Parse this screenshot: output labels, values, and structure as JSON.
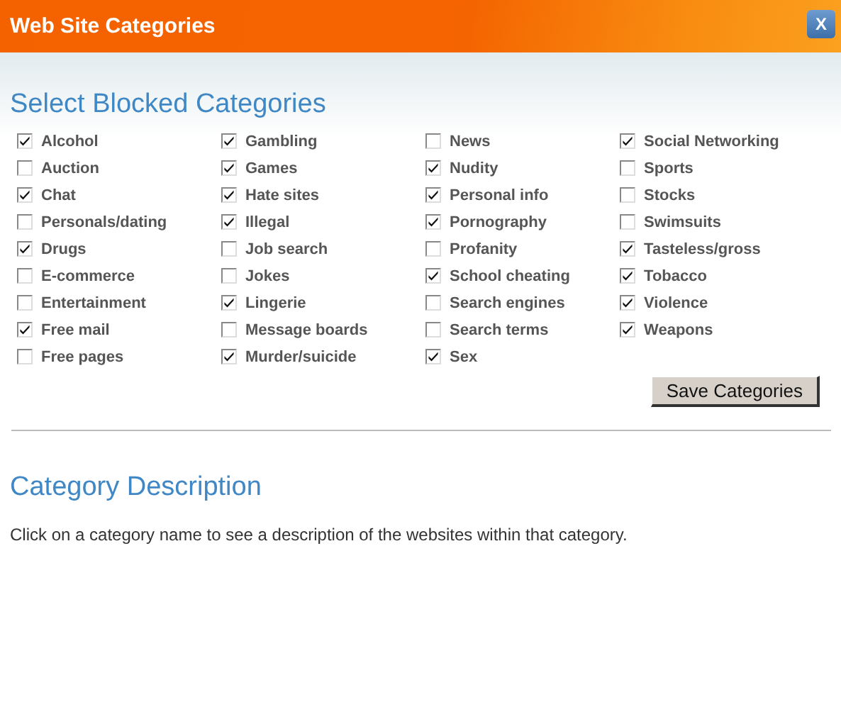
{
  "window": {
    "title": "Web Site Categories",
    "close_label": "X"
  },
  "blocked": {
    "heading": "Select Blocked Categories",
    "columns": [
      [
        {
          "label": "Alcohol",
          "checked": true
        },
        {
          "label": "Auction",
          "checked": false
        },
        {
          "label": "Chat",
          "checked": true
        },
        {
          "label": "Personals/dating",
          "checked": false
        },
        {
          "label": "Drugs",
          "checked": true
        },
        {
          "label": "E-commerce",
          "checked": false
        },
        {
          "label": "Entertainment",
          "checked": false
        },
        {
          "label": "Free mail",
          "checked": true
        },
        {
          "label": "Free pages",
          "checked": false
        }
      ],
      [
        {
          "label": "Gambling",
          "checked": true
        },
        {
          "label": "Games",
          "checked": true
        },
        {
          "label": "Hate sites",
          "checked": true
        },
        {
          "label": "Illegal",
          "checked": true
        },
        {
          "label": "Job search",
          "checked": false
        },
        {
          "label": "Jokes",
          "checked": false
        },
        {
          "label": "Lingerie",
          "checked": true
        },
        {
          "label": "Message boards",
          "checked": false
        },
        {
          "label": "Murder/suicide",
          "checked": true
        }
      ],
      [
        {
          "label": "News",
          "checked": false
        },
        {
          "label": "Nudity",
          "checked": true
        },
        {
          "label": "Personal info",
          "checked": true
        },
        {
          "label": "Pornography",
          "checked": true
        },
        {
          "label": "Profanity",
          "checked": false
        },
        {
          "label": "School cheating",
          "checked": true
        },
        {
          "label": "Search engines",
          "checked": false
        },
        {
          "label": "Search terms",
          "checked": false
        },
        {
          "label": "Sex",
          "checked": true
        }
      ],
      [
        {
          "label": "Social Networking",
          "checked": true
        },
        {
          "label": "Sports",
          "checked": false
        },
        {
          "label": "Stocks",
          "checked": false
        },
        {
          "label": "Swimsuits",
          "checked": false
        },
        {
          "label": "Tasteless/gross",
          "checked": true
        },
        {
          "label": "Tobacco",
          "checked": true
        },
        {
          "label": "Violence",
          "checked": true
        },
        {
          "label": "Weapons",
          "checked": true
        }
      ]
    ],
    "save_button": "Save Categories"
  },
  "description": {
    "heading": "Category Description",
    "text": "Click on a category name to see a description of the websites within that category."
  }
}
